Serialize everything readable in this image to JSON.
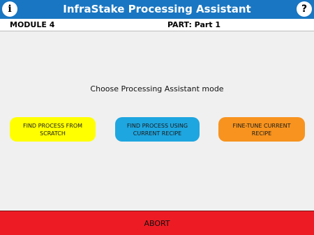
{
  "header": {
    "title": "InfraStake Processing Assistant",
    "info_glyph": "i",
    "help_glyph": "?",
    "bar_color": "#1976c2"
  },
  "subheader": {
    "module": "MODULE 4",
    "part": "PART: Part 1"
  },
  "main": {
    "prompt": "Choose Processing Assistant mode",
    "modes": [
      {
        "label": "FIND PROCESS FROM SCRATCH",
        "color": "#ffff00"
      },
      {
        "label": "FIND PROCESS USING CURRENT RECIPE",
        "color": "#1ea6e0"
      },
      {
        "label": "FINE-TUNE CURRENT RECIPE",
        "color": "#f7931e"
      }
    ]
  },
  "footer": {
    "abort_label": "ABORT",
    "abort_color": "#ed1c24"
  }
}
